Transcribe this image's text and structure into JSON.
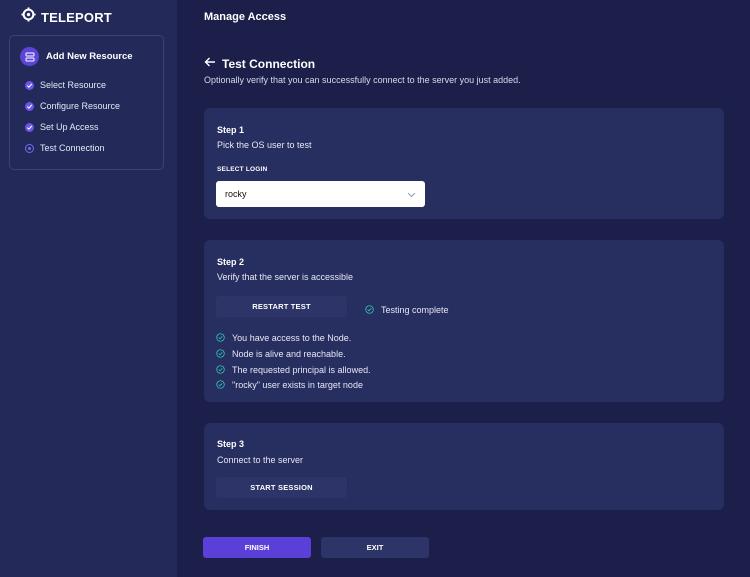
{
  "brand": {
    "name": "TELEPORT",
    "icon": "teleport-logo-icon"
  },
  "sidebar": {
    "header": {
      "label": "Add New Resource",
      "icon": "server-icon"
    },
    "items": [
      {
        "label": "Select Resource",
        "status": "done"
      },
      {
        "label": "Configure Resource",
        "status": "done"
      },
      {
        "label": "Set Up Access",
        "status": "done"
      },
      {
        "label": "Test Connection",
        "status": "current"
      }
    ]
  },
  "header": {
    "title": "Manage Access"
  },
  "page": {
    "title": "Test Connection",
    "subtitle": "Optionally verify that you can successfully connect to the server you just added."
  },
  "step1": {
    "title": "Step 1",
    "description": "Pick the OS user to test",
    "select_label": "SELECT LOGIN",
    "select_value": "rocky"
  },
  "step2": {
    "title": "Step 2",
    "description": "Verify that the server is accessible",
    "button": "RESTART TEST",
    "status": "Testing complete",
    "checks": [
      "You have access to the Node.",
      "Node is alive and reachable.",
      "The requested principal is allowed.",
      "\"rocky\" user exists in target node"
    ]
  },
  "step3": {
    "title": "Step 3",
    "description": "Connect to the server",
    "button": "START SESSION"
  },
  "footer": {
    "finish": "FINISH",
    "exit": "EXIT"
  },
  "colors": {
    "background": "#1b1f4a",
    "sidebar": "#232a5a",
    "card": "#272e60",
    "accent": "#5a3fd8",
    "check": "#2fc6b6"
  }
}
